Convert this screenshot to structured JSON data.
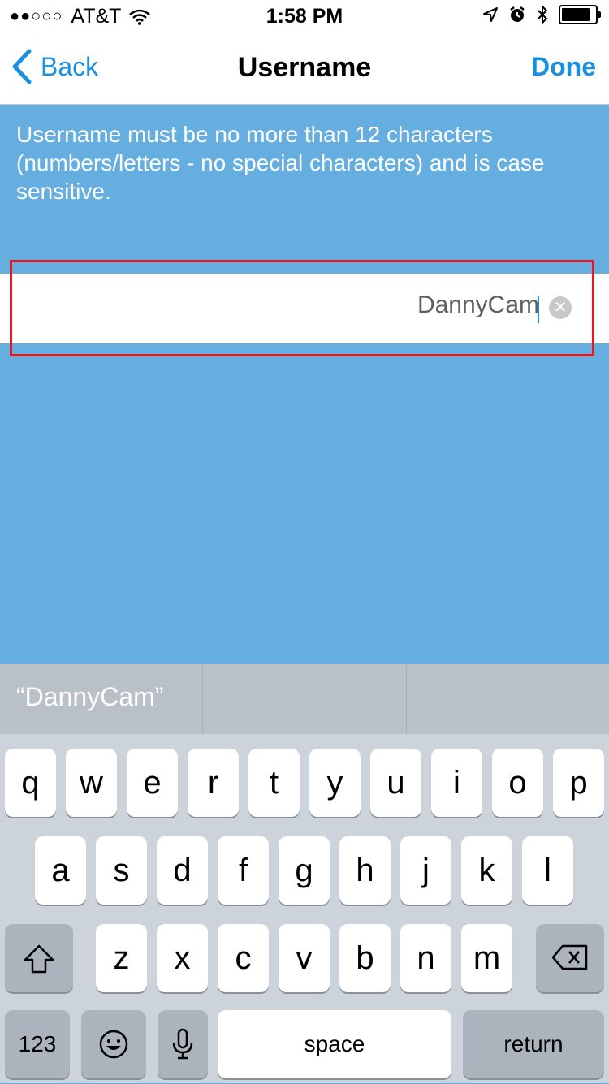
{
  "status_bar": {
    "carrier": "AT&T",
    "time": "1:58 PM"
  },
  "nav": {
    "back_label": "Back",
    "title": "Username",
    "done_label": "Done"
  },
  "info_text": "Username must be no more than 12 characters (numbers/letters - no special characters) and is case sensitive.",
  "username_field": {
    "value": "DannyCam"
  },
  "suggestions": [
    "“DannyCam”",
    "",
    ""
  ],
  "keyboard": {
    "row1": [
      "q",
      "w",
      "e",
      "r",
      "t",
      "y",
      "u",
      "i",
      "o",
      "p"
    ],
    "row2": [
      "a",
      "s",
      "d",
      "f",
      "g",
      "h",
      "j",
      "k",
      "l"
    ],
    "row3": [
      "z",
      "x",
      "c",
      "v",
      "b",
      "n",
      "m"
    ],
    "numbers_label": "123",
    "space_label": "space",
    "return_label": "return"
  },
  "colors": {
    "accent": "#1b8fe0",
    "background": "#66aedf",
    "highlight": "#e01b24"
  }
}
